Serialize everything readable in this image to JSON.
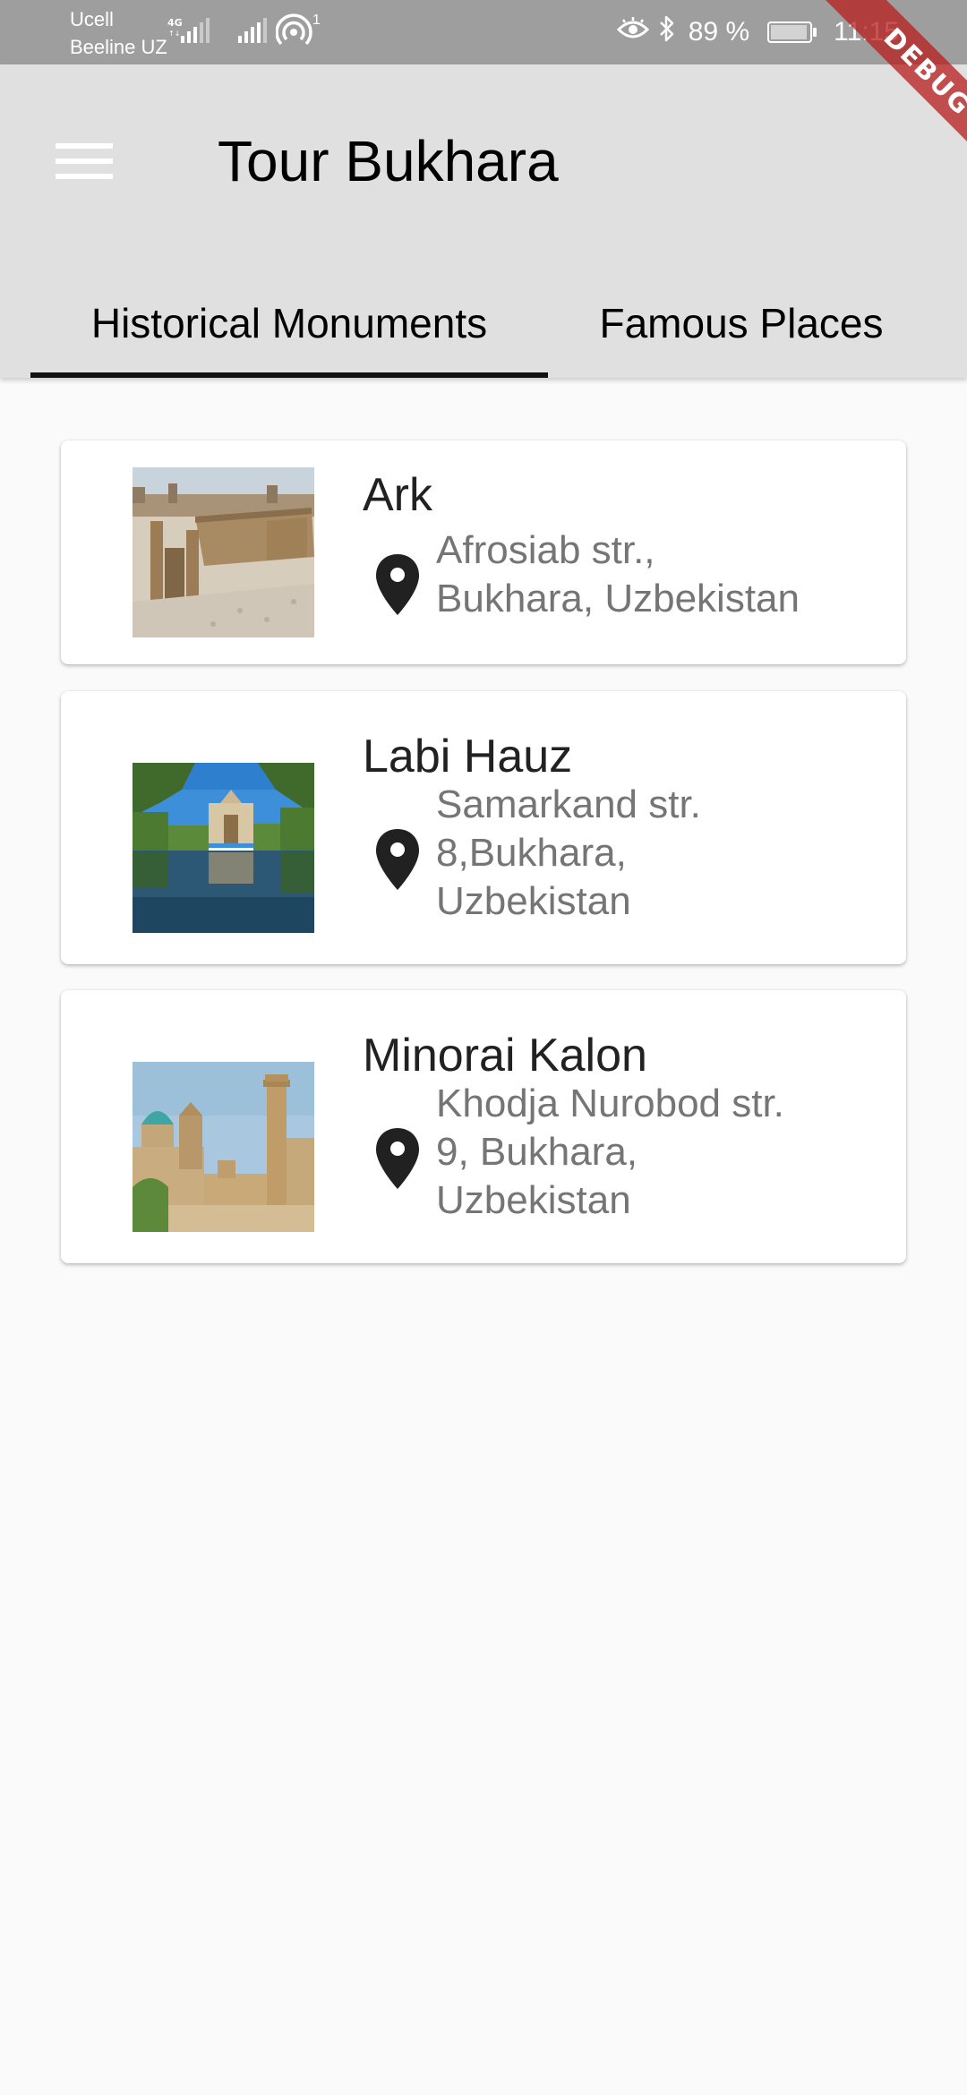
{
  "status_bar": {
    "carrier_1": "Ucell",
    "carrier_2": "Beeline UZ",
    "network_type": "4G",
    "hotspot_count": "1",
    "battery_percent": "89 %",
    "time": "11:15",
    "icons": [
      "signal-4g-icon",
      "signal-icon",
      "hotspot-icon",
      "eye-comfort-icon",
      "bluetooth-icon",
      "battery-icon"
    ]
  },
  "app_bar": {
    "title": "Tour Bukhara",
    "menu_icon": "hamburger-menu-icon"
  },
  "tabs": [
    {
      "label": "Historical Monuments",
      "selected": true
    },
    {
      "label": "Famous Places",
      "selected": false
    }
  ],
  "debug_banner": "DEBUG",
  "places": [
    {
      "name": "Ark",
      "address_lines": [
        "Afrosiab str.,",
        "Bukhara, Uzbekistan"
      ],
      "icon": "location-pin-icon"
    },
    {
      "name": "Labi Hauz",
      "address_lines": [
        "Samarkand str.",
        "8,Bukhara,",
        "Uzbekistan"
      ],
      "icon": "location-pin-icon"
    },
    {
      "name": "Minorai Kalon",
      "address_lines": [
        "Khodja Nurobod str.",
        "9, Bukhara,",
        "Uzbekistan"
      ],
      "icon": "location-pin-icon"
    }
  ],
  "colors": {
    "status_bar": "#9e9e9e",
    "app_bar": "#e0e0e0",
    "background": "#fafafa",
    "card": "#ffffff",
    "title_text": "#000000",
    "address_text": "#757575",
    "tab_indicator": "#111111",
    "debug_ribbon": "#b71c1c"
  }
}
